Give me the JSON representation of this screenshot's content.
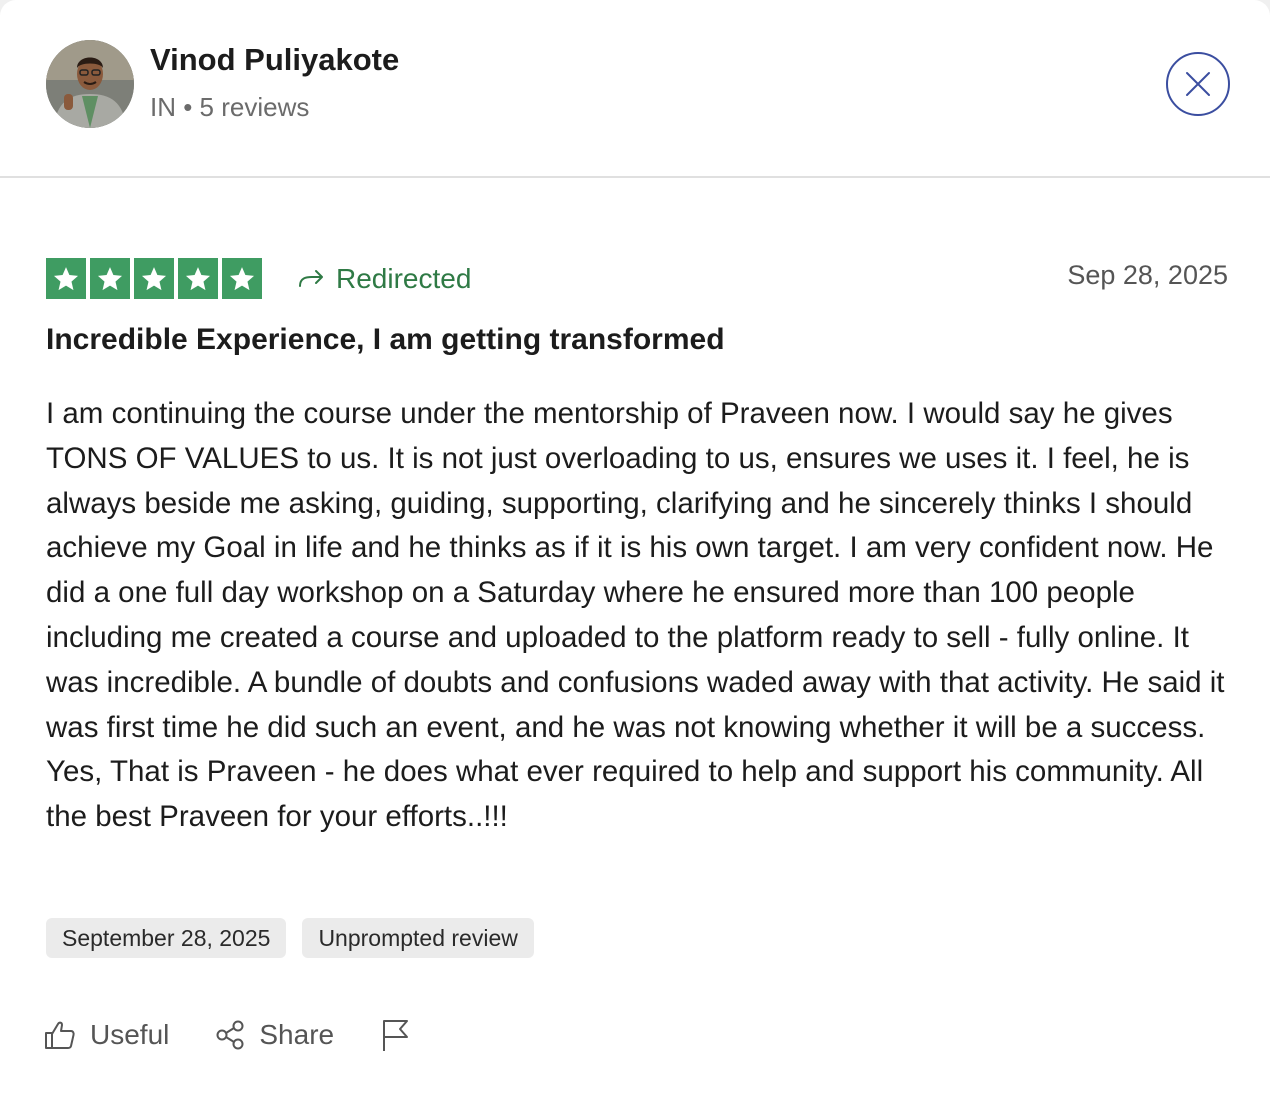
{
  "reviewer": {
    "name": "Vinod Puliyakote",
    "meta": "IN • 5 reviews"
  },
  "review": {
    "rating": 5,
    "rating_max": 5,
    "source_label": "Redirected",
    "date": "Sep 28, 2025",
    "title": "Incredible Experience, I am getting transformed",
    "body": "I am continuing the course under the mentorship of Praveen now. I would say he gives TONS OF VALUES to us. It is not just overloading to us, ensures we uses it. I feel, he is always beside me asking, guiding, supporting, clarifying and he sincerely thinks I should achieve my Goal in life and he thinks as if it is his own target. I am very confident now. He did a one full day workshop on a Saturday where he ensured more than 100 people including me created a course and uploaded to the platform ready to sell - fully online. It was incredible. A bundle of doubts and confusions waded away with that activity. He said it was first time he did such an event, and he was not knowing whether it will be a success. Yes, That is Praveen - he does what ever required to help and support his community. All the best Praveen for your efforts..!!!",
    "tags": [
      "September 28, 2025",
      "Unprompted review"
    ]
  },
  "actions": {
    "useful_label": "Useful",
    "share_label": "Share"
  },
  "icons": {
    "close": "close-icon",
    "star": "star-icon",
    "redirect": "redirect-arrow-icon",
    "useful": "thumbs-up-icon",
    "share": "share-icon",
    "flag": "flag-icon"
  },
  "colors": {
    "star_green": "#3f9c62",
    "redirect_green": "#2f7a45",
    "close_blue": "#3b4ea0",
    "tag_bg": "#ebebeb"
  }
}
